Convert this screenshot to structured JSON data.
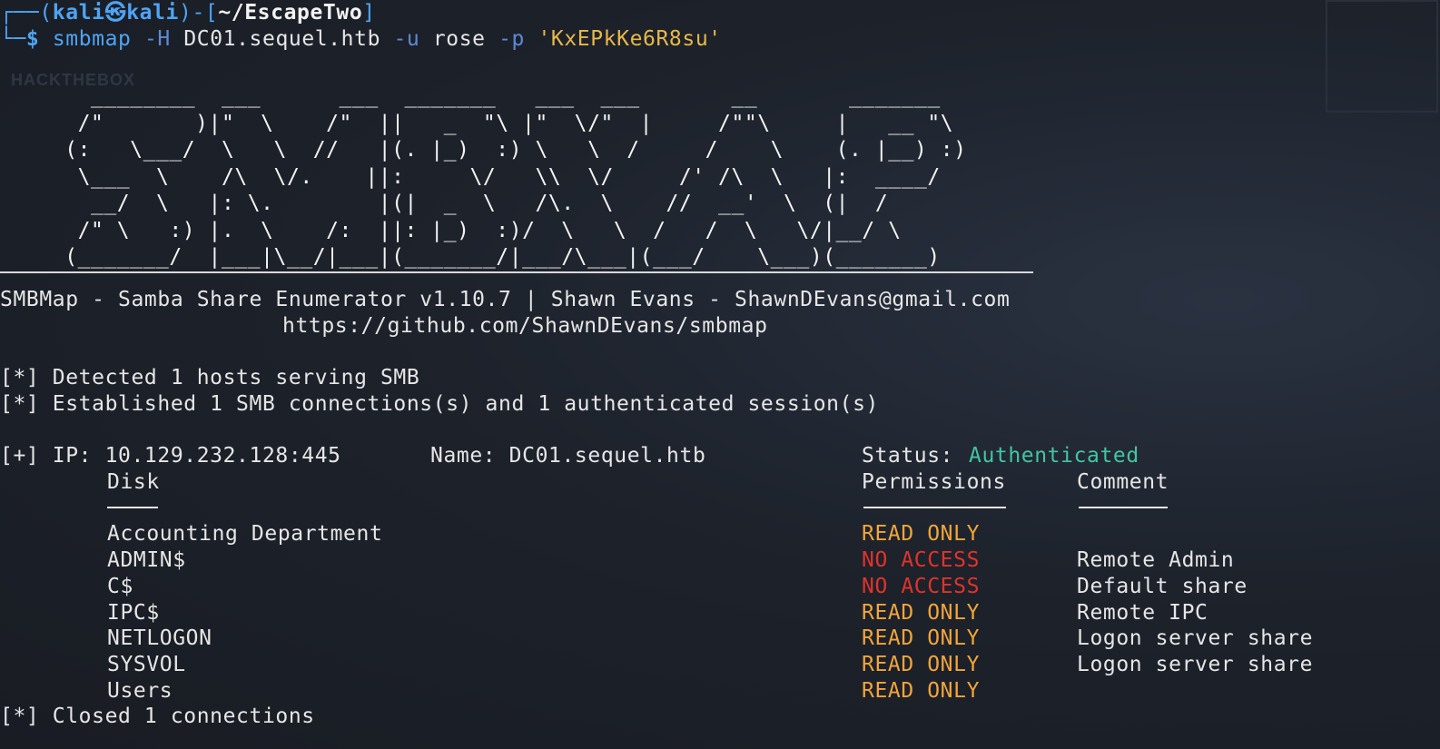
{
  "prompt": {
    "corner": "┌──(",
    "user": "kali",
    "at_symbol": "㉿",
    "host": "kali",
    "close": ")-[",
    "path": "~/EscapeTwo",
    "close_bracket": "]",
    "corner2": "└─",
    "dollar": "$",
    "cmd": "smbmap",
    "flag_h": "-H",
    "host_arg": "DC01.sequel.htb",
    "flag_u": "-u",
    "user_arg": "rose",
    "flag_p": "-p",
    "password": "'KxEPkKe6R8su'"
  },
  "banner_art": "     ________  ___      ___  _______   ___  ___       __       _______\n    /\"       )|\"  \\    /\"  ||   _  \"\\ |\"  \\/\"  |     /\"\"\\     |   __ \"\\\n   (:   \\___/  \\   \\  //   |(. |_)  :) \\   \\  /     /    \\    (. |__) :)\n    \\___  \\    /\\  \\/.    ||:     \\/   \\\\  \\/     /' /\\  \\   |:  ____/\n     __/  \\   |: \\.        |(|  _  \\   /\\.  \\    //  __'  \\  (|  /\n    /\" \\   :) |.  \\    /:  ||: |_)  :)/  \\   \\  /   /  \\   \\/|__/ \\\n   (_______/  |___|\\__/|___|(_______/|___/\\___|(___/    \\___)(_______)",
  "tool_info": {
    "line1": "SMBMap - Samba Share Enumerator v1.10.7 | Shawn Evans - ShawnDEvans@gmail.com",
    "line2": "https://github.com/ShawnDEvans/smbmap"
  },
  "messages": {
    "detected": "[*] Detected 1 hosts serving SMB",
    "established": "[*] Established 1 SMB connections(s) and 1 authenticated session(s)",
    "closed": "[*] Closed 1 connections"
  },
  "host_line": {
    "prefix": "[+] IP: 10.129.232.128:445",
    "name": "Name: DC01.sequel.htb",
    "status_label": "Status:",
    "status_value": "Authenticated"
  },
  "table": {
    "headers": {
      "disk": "Disk",
      "permissions": "Permissions",
      "comment": "Comment"
    },
    "rows": [
      {
        "disk": "Accounting Department",
        "permissions": "READ ONLY",
        "comment": ""
      },
      {
        "disk": "ADMIN$",
        "permissions": "NO ACCESS",
        "comment": "Remote Admin"
      },
      {
        "disk": "C$",
        "permissions": "NO ACCESS",
        "comment": "Default share"
      },
      {
        "disk": "IPC$",
        "permissions": "READ ONLY",
        "comment": "Remote IPC"
      },
      {
        "disk": "NETLOGON",
        "permissions": "READ ONLY",
        "comment": "Logon server share"
      },
      {
        "disk": "SYSVOL",
        "permissions": "READ ONLY",
        "comment": "Logon server share"
      },
      {
        "disk": "Users",
        "permissions": "READ ONLY",
        "comment": ""
      }
    ]
  },
  "colors": {
    "prompt_blue": "#4ea4f4",
    "string_yellow": "#e8b84a",
    "authenticated_green": "#42c6a0",
    "read_only_amber": "#f2a53a",
    "no_access_red": "#e0332c"
  },
  "background_ghost": {
    "logo_text": "HACKTHEBOX"
  }
}
